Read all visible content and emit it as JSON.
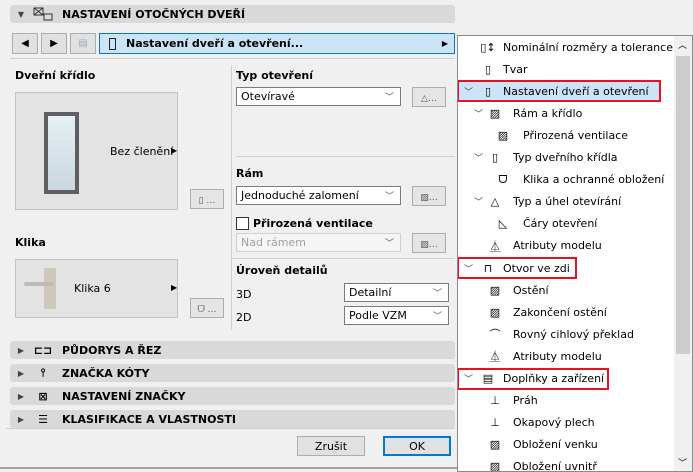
{
  "main_section": {
    "title": "NASTAVENÍ OTOČNÝCH DVEŘÍ",
    "expanded": true
  },
  "nav": {
    "current_page": "Nastavení dveří a otevření..."
  },
  "leaf": {
    "label": "Dveřní křídlo",
    "preview_label": "Bez členění"
  },
  "handle": {
    "label": "Klika",
    "preview_label": "Klika 6"
  },
  "opening_type": {
    "label": "Typ otevření",
    "value": "Otevíravé"
  },
  "frame": {
    "label": "Rám",
    "value": "Jednoduché zalomení"
  },
  "ventilation": {
    "label": "Přirozená ventilace",
    "checked": false,
    "value": "Nad rámem",
    "enabled": false
  },
  "detail": {
    "label": "Úroveň detailů",
    "rows": [
      {
        "label": "3D",
        "value": "Detailní"
      },
      {
        "label": "2D",
        "value": "Podle VZM"
      }
    ]
  },
  "sections": [
    {
      "title": "PŮDORYS A ŘEZ",
      "icon": "floorplan-icon"
    },
    {
      "title": "ZNAČKA KÓTY",
      "icon": "dimension-marker-icon"
    },
    {
      "title": "NASTAVENÍ ZNAČKY",
      "icon": "marker-settings-icon"
    },
    {
      "title": "KLASIFIKACE A VLASTNOSTI",
      "icon": "classification-icon"
    }
  ],
  "buttons": {
    "cancel": "Zrušit",
    "ok": "OK"
  },
  "tree": [
    {
      "label": "Nominální rozměry a tolerance",
      "level": 0,
      "chevron": false,
      "icon": "door-dimension-icon"
    },
    {
      "label": "Tvar",
      "level": 0,
      "chevron": false,
      "icon": "door-shape-icon"
    },
    {
      "label": "Nastavení dveří a otevření",
      "level": 0,
      "chevron": true,
      "icon": "door-icon",
      "selected": true,
      "highlighted": true
    },
    {
      "label": "Rám a křídlo",
      "level": 1,
      "chevron": true,
      "icon": "frame-icon"
    },
    {
      "label": "Přirozená ventilace",
      "level": 2,
      "chevron": false,
      "icon": "ventilation-icon"
    },
    {
      "label": "Typ dveřního křídla",
      "level": 1,
      "chevron": true,
      "icon": "door-leaf-icon"
    },
    {
      "label": "Klika a ochranné obložení",
      "level": 2,
      "chevron": false,
      "icon": "handle-icon"
    },
    {
      "label": "Typ a úhel otevírání",
      "level": 1,
      "chevron": true,
      "icon": "opening-angle-icon"
    },
    {
      "label": "Čáry otevření",
      "level": 2,
      "chevron": false,
      "icon": "opening-lines-icon"
    },
    {
      "label": "Atributy modelu",
      "level": 1,
      "chevron": false,
      "icon": "paint-brush-icon"
    },
    {
      "label": "Otvor ve zdi",
      "level": 0,
      "chevron": true,
      "icon": "wall-opening-icon",
      "highlighted": true
    },
    {
      "label": "Ostění",
      "level": 1,
      "chevron": false,
      "icon": "reveal-icon"
    },
    {
      "label": "Zakončení ostění",
      "level": 1,
      "chevron": false,
      "icon": "reveal-end-icon"
    },
    {
      "label": "Rovný cihlový překlad",
      "level": 1,
      "chevron": false,
      "icon": "brick-lintel-icon"
    },
    {
      "label": "Atributy modelu",
      "level": 1,
      "chevron": false,
      "icon": "paint-brush-icon"
    },
    {
      "label": "Doplňky a zařízení",
      "level": 0,
      "chevron": true,
      "icon": "accessories-icon",
      "highlighted": true
    },
    {
      "label": "Práh",
      "level": 1,
      "chevron": false,
      "icon": "threshold-icon"
    },
    {
      "label": "Okapový plech",
      "level": 1,
      "chevron": false,
      "icon": "sill-icon"
    },
    {
      "label": "Obložení venku",
      "level": 1,
      "chevron": false,
      "icon": "outside-trim-icon"
    },
    {
      "label": "Obložení uvnitř",
      "level": 1,
      "chevron": false,
      "icon": "inside-trim-icon"
    }
  ],
  "colors": {
    "selection": "#cce4f7",
    "accent": "#0078d7",
    "highlight": "#e81123"
  }
}
